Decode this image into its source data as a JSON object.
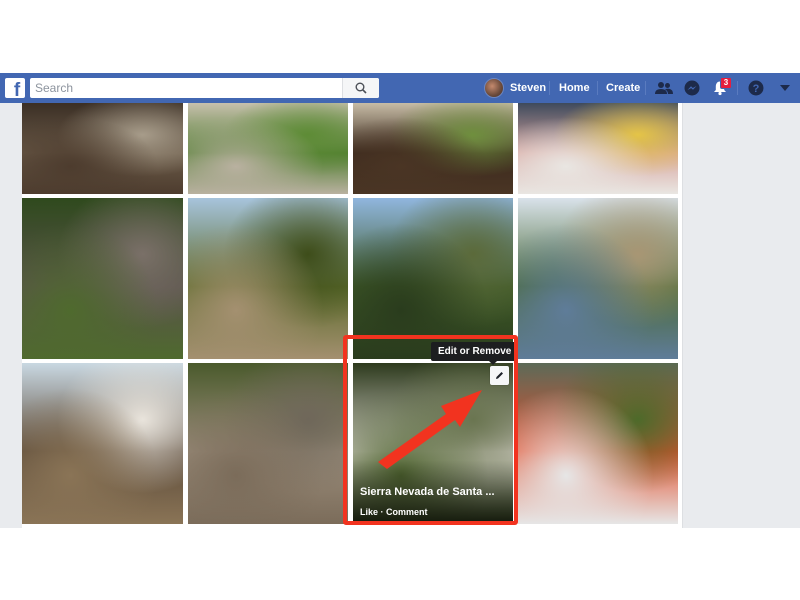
{
  "topbar": {
    "logo": "f",
    "search": {
      "placeholder": "Search",
      "value": ""
    },
    "user_name": "Steven",
    "home_label": "Home",
    "create_label": "Create",
    "icons": {
      "friends": "friend-requests-icon",
      "messenger": "messenger-icon",
      "notifications": "notifications-bell-icon",
      "help": "help-icon",
      "menu": "caret-down-icon"
    },
    "notification_count": "3",
    "brand_color": "#4267b2"
  },
  "photos": {
    "rows": [
      [
        {
          "subject": "dirt garden bed with tree",
          "colors": [
            "#3b2f25",
            "#4d3c2e",
            "#6a5a48",
            "#a79c8a"
          ]
        },
        {
          "subject": "lawn with hose and mulch bed",
          "colors": [
            "#c7c0ad",
            "#b9b1a0",
            "#4f7d2f",
            "#5e8c36"
          ]
        },
        {
          "subject": "mulched yard with steps",
          "colors": [
            "#c7bca6",
            "#4a3524",
            "#3c2a1e",
            "#6f8f3e"
          ]
        },
        {
          "subject": "child with white stuffed toy",
          "colors": [
            "#3e4a5c",
            "#e9e6e2",
            "#d8a6a0",
            "#e4c447"
          ]
        }
      ],
      [
        {
          "subject": "person in white on rock under banana trees",
          "colors": [
            "#2f4a1d",
            "#4f6a2e",
            "#59524a",
            "#7a7068"
          ]
        },
        {
          "subject": "hiker on grassy hillside",
          "colors": [
            "#a7c4dc",
            "#a49070",
            "#5a6a2a",
            "#3e4d1a"
          ]
        },
        {
          "subject": "hikers by river in jungle",
          "colors": [
            "#90b6de",
            "#2a3c1d",
            "#3f5a28",
            "#5b6a3a"
          ]
        },
        {
          "subject": "thatched huts and mountains",
          "colors": [
            "#d9e2ea",
            "#5f7c99",
            "#4a6a36",
            "#a89674"
          ]
        }
      ],
      [
        {
          "subject": "indigenous people in front of thatched hut",
          "colors": [
            "#c9d8e2",
            "#8a7456",
            "#5c4b3a",
            "#e9e4dc"
          ]
        },
        {
          "subject": "child on dirt path among huts",
          "colors": [
            "#4a5a2c",
            "#7b6c5a",
            "#9c8e7c",
            "#6f675a"
          ]
        },
        {
          "subject": "river pool with rocks in jungle",
          "colors": [
            "#2d3a1d",
            "#4f6430",
            "#d4d0c8",
            "#6a7550"
          ]
        },
        {
          "subject": "campers with orange tents",
          "colors": [
            "#5c6a58",
            "#e6e6e6",
            "#e2502e",
            "#4d6a2a"
          ]
        }
      ]
    ],
    "selected": {
      "title": "Sierra Nevada de Santa ...",
      "like_label": "Like",
      "separator": " · ",
      "comment_label": "Comment",
      "tooltip": "Edit or Remove",
      "edit_icon": "pencil-icon"
    }
  },
  "annotation": {
    "highlight_color": "#f2331f",
    "arrow_color": "#f2331f"
  }
}
